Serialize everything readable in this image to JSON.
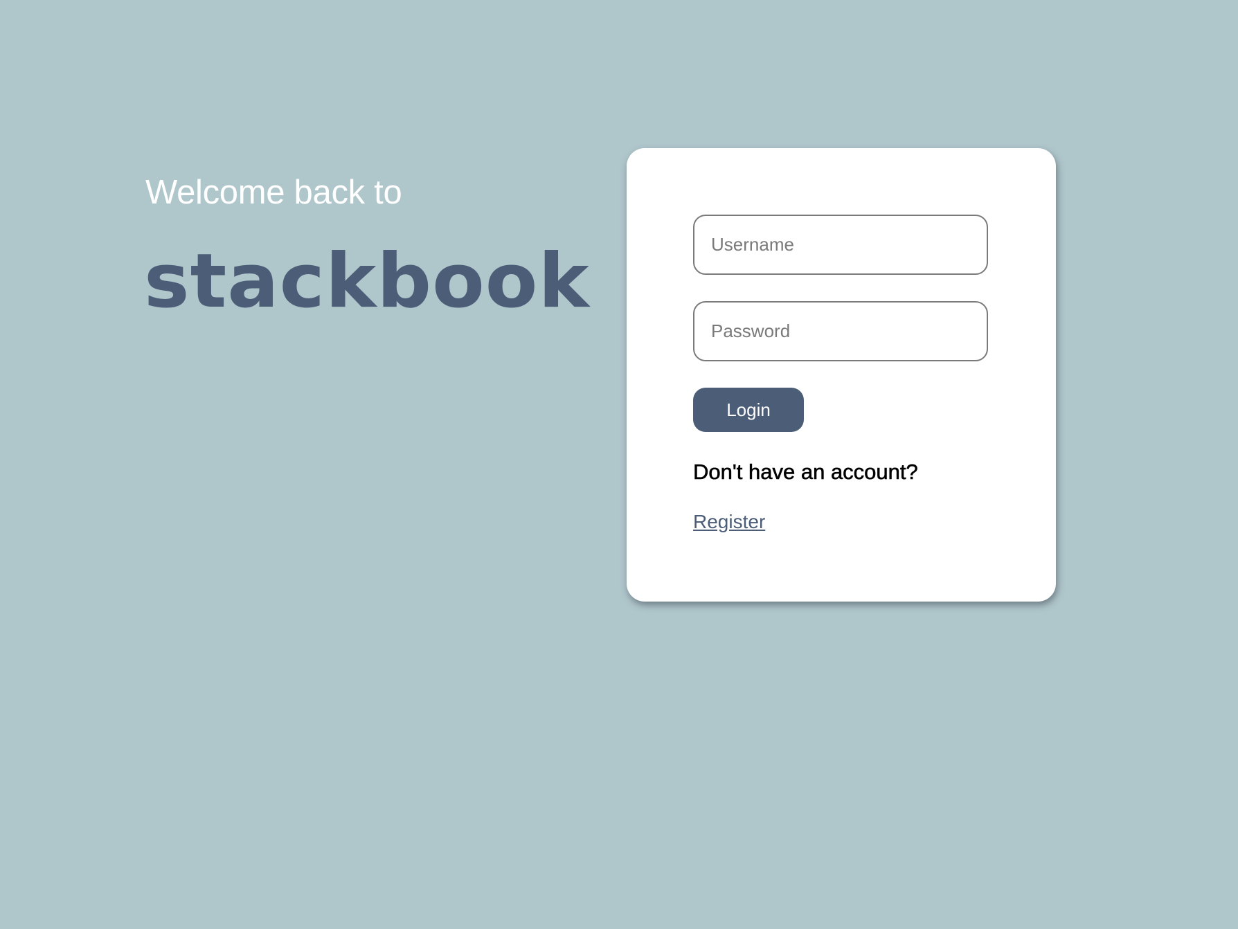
{
  "hero": {
    "welcome_text": "Welcome back to",
    "brand_name": "stackbook"
  },
  "login_form": {
    "username_placeholder": "Username",
    "username_value": "",
    "password_placeholder": "Password",
    "password_value": "",
    "login_label": "Login",
    "no_account_text": "Don't have an account?",
    "register_label": "Register"
  },
  "colors": {
    "background": "#afc6cb",
    "brand": "#4c5d78",
    "card": "#ffffff"
  }
}
